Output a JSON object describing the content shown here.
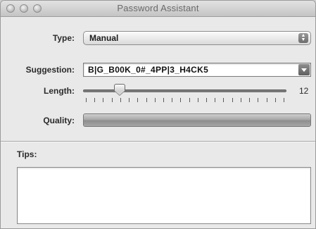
{
  "window": {
    "title": "Password Assistant",
    "traffic_lights": [
      "close",
      "minimize",
      "zoom"
    ]
  },
  "type_field": {
    "label": "Type:",
    "selected": "Manual"
  },
  "suggestion_field": {
    "label": "Suggestion:",
    "value": "B|G_B00K_0#_4PP|3_H4CK5"
  },
  "length_field": {
    "label": "Length:",
    "value": "12",
    "value_fraction": 0.18,
    "tick_count": 24
  },
  "quality_field": {
    "label": "Quality:",
    "level_fraction": 1.0
  },
  "tips": {
    "label": "Tips:",
    "text": ""
  }
}
